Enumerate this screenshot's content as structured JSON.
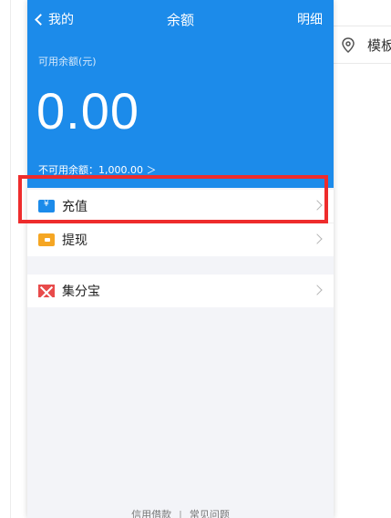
{
  "header": {
    "back_label": "我的",
    "title": "余额",
    "right_label": "明细"
  },
  "balance": {
    "available_label": "可用余额(元)",
    "amount": "0.00",
    "unavailable_text": "不可用余额：1,000.00 ＞"
  },
  "menu": {
    "group1": [
      {
        "label": "充值",
        "icon": "recharge-icon"
      },
      {
        "label": "提现",
        "icon": "withdraw-icon"
      }
    ],
    "group2": [
      {
        "label": "集分宝",
        "icon": "jifenbao-icon"
      }
    ]
  },
  "footer": {
    "link1": "信用借款",
    "separator": "|",
    "link2": "常见问题"
  },
  "side": {
    "template_label": "模板"
  },
  "colors": {
    "primary": "#1c8bea",
    "highlight": "#ee2c2c",
    "withdraw": "#f5a623",
    "jifen": "#e84b4b"
  }
}
